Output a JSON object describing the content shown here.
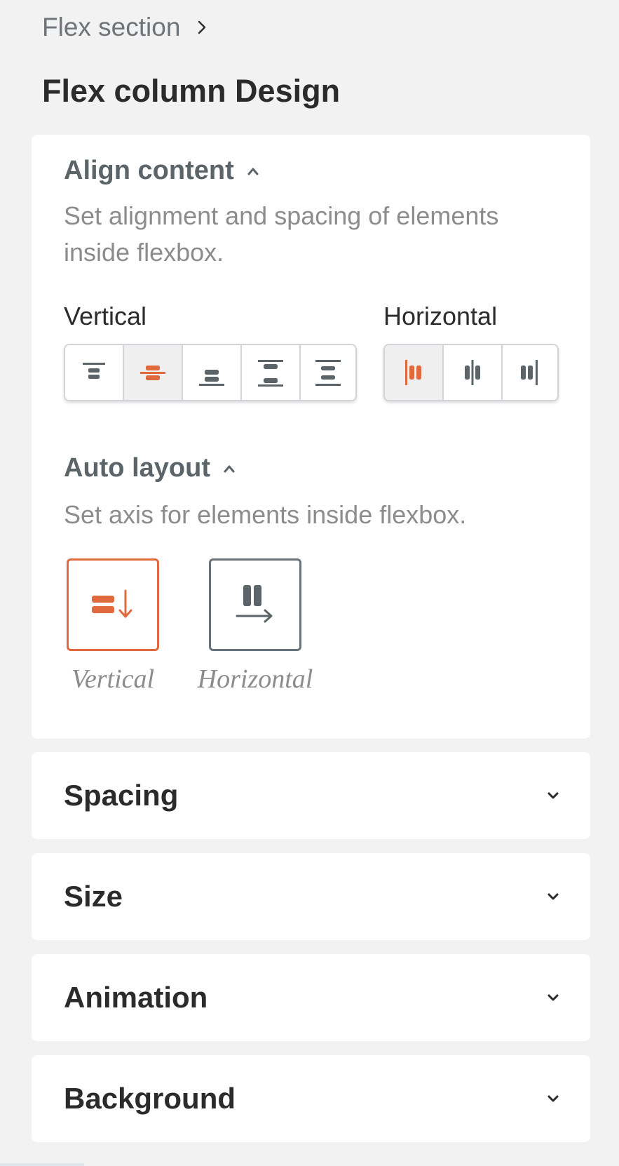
{
  "breadcrumb": {
    "label": "Flex section"
  },
  "page_title": "Flex column Design",
  "align_content": {
    "title": "Align content",
    "description": "Set alignment and spacing of elements inside flexbox.",
    "vertical_label": "Vertical",
    "horizontal_label": "Horizontal",
    "vertical_selected": "align-center",
    "horizontal_selected": "align-start"
  },
  "auto_layout": {
    "title": "Auto layout",
    "description": "Set axis for elements inside flexbox.",
    "options": [
      {
        "label": "Vertical",
        "icon": "vertical-axis-icon",
        "selected": true
      },
      {
        "label": "Horizontal",
        "icon": "horizontal-axis-icon",
        "selected": false
      }
    ]
  },
  "sections": [
    {
      "title": "Spacing"
    },
    {
      "title": "Size"
    },
    {
      "title": "Animation"
    },
    {
      "title": "Background"
    }
  ],
  "colors": {
    "accent": "#e0693e",
    "icon": "#5b6569",
    "background": "#f2f2f2"
  }
}
